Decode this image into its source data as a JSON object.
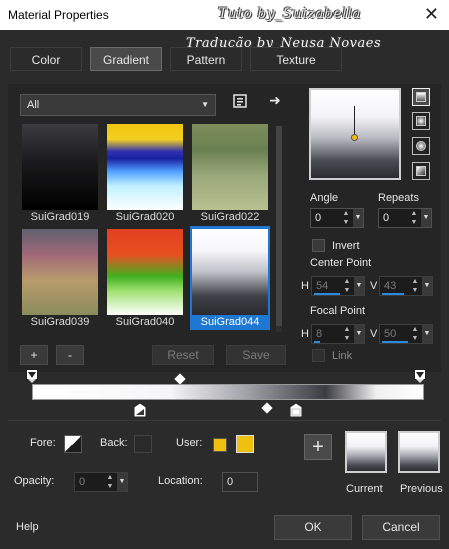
{
  "window": {
    "title": "Material Properties",
    "close_glyph": "✕"
  },
  "watermark": {
    "line1": "Tuto by_Suizabella",
    "line2": "Tradução by_Neusa Novaes"
  },
  "tabs": [
    {
      "label": "Color",
      "active": false
    },
    {
      "label": "Gradient",
      "active": true
    },
    {
      "label": "Pattern",
      "active": false
    },
    {
      "label": "Texture",
      "active": false
    }
  ],
  "library": {
    "selected": "All",
    "dropdown_arrow": "▼",
    "folder_icon": "library-icon",
    "next_icon": "➜"
  },
  "gradients": [
    {
      "label": "SuiGrad019",
      "css": "linear-gradient(to bottom, #3c3c40 0%, #1a1a1c 45%, #000000 100%)"
    },
    {
      "label": "SuiGrad020",
      "css": "linear-gradient(to bottom, #f1c40f 0%, #f1d020 18%, #3030b0 32%, #1820a0 40%, #50a0ff 55%, #c0f0ff 72%, #ffffff 100%)"
    },
    {
      "label": "SuiGrad022",
      "css": "linear-gradient(to bottom, #7e8d5c 0%, #6a8050 30%, #9aa87a 60%, #b8c090 100%)"
    },
    {
      "label": "SuiGrad039",
      "css": "linear-gradient(to bottom, #606070 0%, #a06878 30%, #b89c6c 60%, #8a8c5c 100%)"
    },
    {
      "label": "SuiGrad040",
      "css": "linear-gradient(to bottom, #e04020 0%, #e85020 30%, #40b020 55%, #a0e070 72%, #ffffff 100%)"
    },
    {
      "label": "SuiGrad044",
      "css": "linear-gradient(to bottom, #ffffff 0%, #f6f6fa 25%, #c0c0c8 50%, #404048 78%, #2a2a30 100%)",
      "selected": true
    }
  ],
  "buttons": {
    "add": "+",
    "remove": "-",
    "reset": "Reset",
    "save": "Save"
  },
  "angle": {
    "label": "Angle",
    "value": "0"
  },
  "repeats": {
    "label": "Repeats",
    "value": "0"
  },
  "invert": {
    "label": "Invert",
    "checked": false
  },
  "center_point": {
    "label": "Center Point",
    "h_label": "H",
    "h_value": "54",
    "v_label": "V",
    "v_value": "43"
  },
  "focal_point": {
    "label": "Focal Point",
    "h_label": "H",
    "h_value": "8",
    "v_label": "V",
    "v_value": "50"
  },
  "link": {
    "label": "Link",
    "checked": false
  },
  "stop_colors": {
    "fore_label": "Fore:",
    "back_label": "Back:",
    "user_label": "User:",
    "user_color": "#f0c010"
  },
  "opacity": {
    "label": "Opacity:",
    "value": "0"
  },
  "location": {
    "label": "Location:",
    "value": "0"
  },
  "current": {
    "label": "Current"
  },
  "previous": {
    "label": "Previous"
  },
  "footer": {
    "help": "Help",
    "ok": "OK",
    "cancel": "Cancel"
  }
}
